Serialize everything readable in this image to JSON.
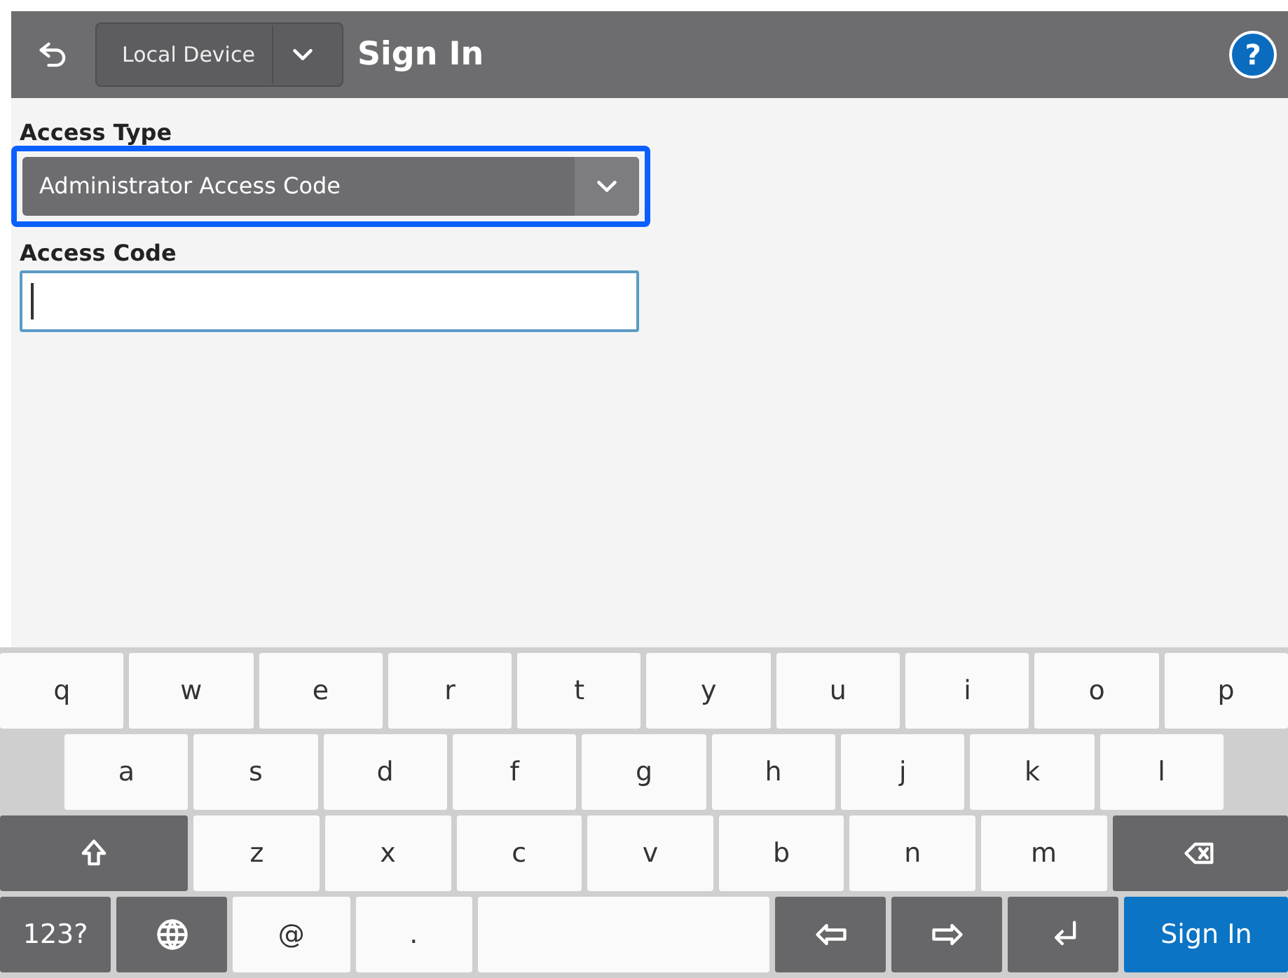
{
  "header": {
    "local_device": {
      "label": "Local Device"
    },
    "title": "Sign In",
    "help": "?"
  },
  "form": {
    "access_type": {
      "label": "Access Type",
      "value": "Administrator Access Code",
      "highlighted": true
    },
    "access_code": {
      "label": "Access Code",
      "focused": true
    }
  },
  "keyboard": {
    "rows": [
      [
        {
          "kind": "char",
          "label": "q"
        },
        {
          "kind": "char",
          "label": "w"
        },
        {
          "kind": "char",
          "label": "e"
        },
        {
          "kind": "char",
          "label": "r"
        },
        {
          "kind": "char",
          "label": "t"
        },
        {
          "kind": "char",
          "label": "y"
        },
        {
          "kind": "char",
          "label": "u"
        },
        {
          "kind": "char",
          "label": "i"
        },
        {
          "kind": "char",
          "label": "o"
        },
        {
          "kind": "char",
          "label": "p"
        }
      ],
      [
        {
          "kind": "char",
          "label": "a"
        },
        {
          "kind": "char",
          "label": "s"
        },
        {
          "kind": "char",
          "label": "d"
        },
        {
          "kind": "char",
          "label": "f"
        },
        {
          "kind": "char",
          "label": "g"
        },
        {
          "kind": "char",
          "label": "h"
        },
        {
          "kind": "char",
          "label": "j"
        },
        {
          "kind": "char",
          "label": "k"
        },
        {
          "kind": "char",
          "label": "l"
        }
      ],
      [
        {
          "kind": "shift"
        },
        {
          "kind": "char",
          "label": "z"
        },
        {
          "kind": "char",
          "label": "x"
        },
        {
          "kind": "char",
          "label": "c"
        },
        {
          "kind": "char",
          "label": "v"
        },
        {
          "kind": "char",
          "label": "b"
        },
        {
          "kind": "char",
          "label": "n"
        },
        {
          "kind": "char",
          "label": "m"
        },
        {
          "kind": "backspace"
        }
      ],
      [
        {
          "kind": "mode",
          "label": "123?"
        },
        {
          "kind": "globe"
        },
        {
          "kind": "char",
          "label": "@"
        },
        {
          "kind": "char",
          "label": "."
        },
        {
          "kind": "space"
        },
        {
          "kind": "left"
        },
        {
          "kind": "right"
        },
        {
          "kind": "enter"
        },
        {
          "kind": "action",
          "label": "Sign In"
        }
      ]
    ]
  }
}
